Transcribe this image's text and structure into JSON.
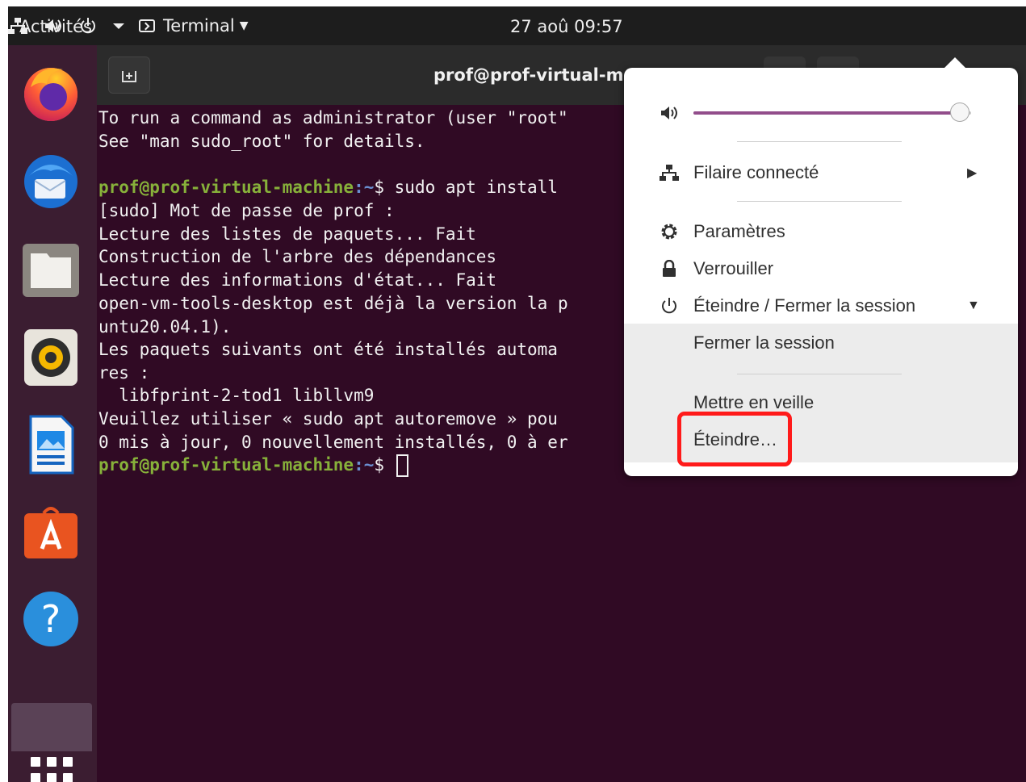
{
  "topbar": {
    "activities": "Activités",
    "app_menu": "Terminal",
    "clock": "27 aoû  09:57",
    "icons": [
      "network-icon",
      "volume-icon",
      "power-icon",
      "chevron-down-icon"
    ]
  },
  "dock": {
    "apps": [
      "firefox-icon",
      "thunderbird-icon",
      "files-icon",
      "rhythmbox-icon",
      "libreoffice-writer-icon",
      "ubuntu-software-icon",
      "help-icon"
    ],
    "show_apps": "apps-grid-icon"
  },
  "terminal": {
    "title": "prof@prof-virtual-ma",
    "lines": [
      {
        "text": "To run a command as administrator (user \"root\""
      },
      {
        "text": "See \"man sudo_root\" for details."
      },
      {
        "text": ""
      },
      {
        "user": "prof@prof-virtual-machine",
        "path": ":~",
        "text": "$ sudo apt install"
      },
      {
        "text": "[sudo] Mot de passe de prof :"
      },
      {
        "text": "Lecture des listes de paquets... Fait"
      },
      {
        "text": "Construction de l'arbre des dépendances"
      },
      {
        "text": "Lecture des informations d'état... Fait"
      },
      {
        "text": "open-vm-tools-desktop est déjà la version la p"
      },
      {
        "text": "untu20.04.1)."
      },
      {
        "text": "Les paquets suivants ont été installés automa"
      },
      {
        "text": "res :"
      },
      {
        "text": "  libfprint-2-tod1 libllvm9"
      },
      {
        "text": "Veuillez utiliser « sudo apt autoremove » pou"
      },
      {
        "text": "0 mis à jour, 0 nouvellement installés, 0 à er"
      },
      {
        "user": "prof@prof-virtual-machine",
        "path": ":~",
        "text": "$ "
      }
    ]
  },
  "system_menu": {
    "volume_level": 0.96,
    "network_label": "Filaire connecté",
    "settings_label": "Paramètres",
    "lock_label": "Verrouiller",
    "power_label": "Éteindre / Fermer la session",
    "logout_label": "Fermer la session",
    "suspend_label": "Mettre en veille",
    "poweroff_label": "Éteindre…"
  },
  "colors": {
    "terminal_bg": "#300a24",
    "prompt_user": "#87b13a",
    "prompt_path": "#6a8fd1",
    "slider_fill": "#924d8b",
    "highlight": "#ff1a1a"
  }
}
